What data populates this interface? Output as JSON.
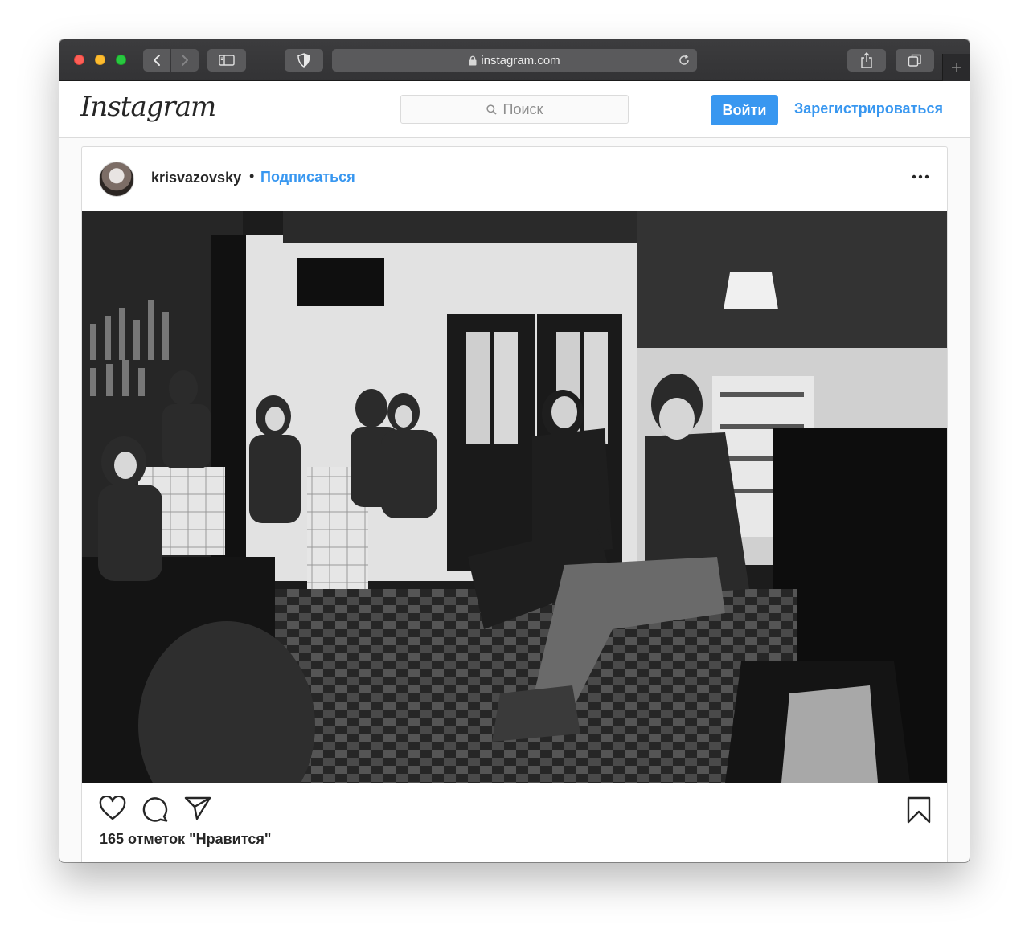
{
  "browser": {
    "url": "instagram.com",
    "colors": {
      "toolbar": "#363638",
      "button": "#5a5a5c",
      "close": "#fe5f57",
      "minimize": "#febc2e",
      "zoom": "#28c840"
    },
    "icons": [
      "back-icon",
      "forward-icon",
      "sidebar-icon",
      "shield-icon",
      "lock-icon",
      "reload-icon",
      "share-icon",
      "tabs-icon",
      "plus-icon"
    ]
  },
  "header": {
    "logo": "Instagram",
    "search_placeholder": "Поиск",
    "login_label": "Войти",
    "signup_label": "Зарегистрироваться",
    "accent": "#3897f0"
  },
  "post": {
    "username": "krisvazovsky",
    "separator": "•",
    "follow_label": "Подписаться",
    "likes_text": "165 отметок \"Нравится\"",
    "icons": [
      "heart-icon",
      "comment-icon",
      "send-icon",
      "bookmark-icon",
      "more-icon"
    ]
  }
}
